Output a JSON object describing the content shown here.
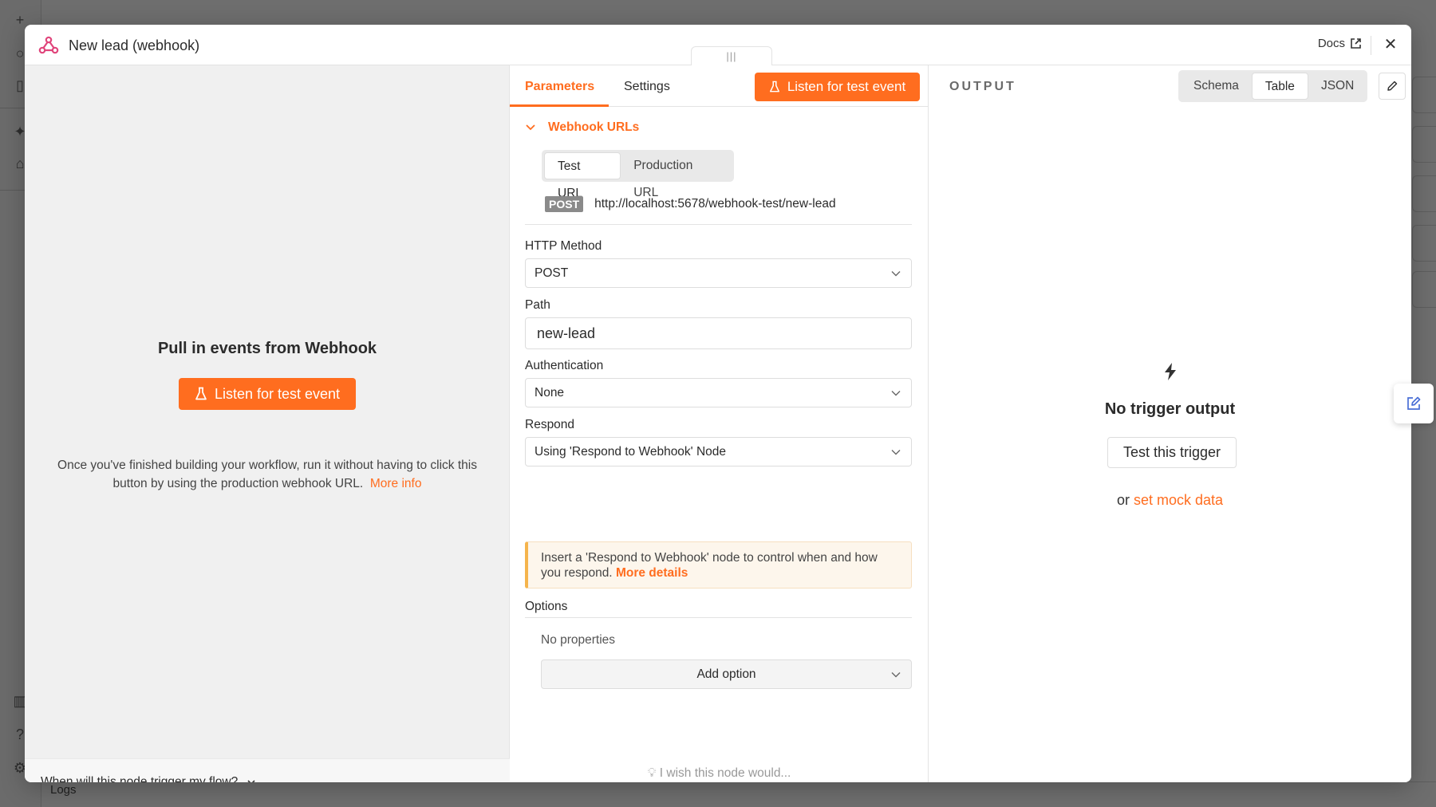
{
  "modal": {
    "title": "New lead (webhook)",
    "docs_label": "Docs",
    "drag_handle": "|||"
  },
  "left": {
    "heading": "Pull in events from Webhook",
    "listen_button": "Listen for test event",
    "description": "Once you've finished building your workflow, run it without having to click this button by using the production webhook URL.",
    "more_info": "More info",
    "footer_question": "When will this node trigger my flow?"
  },
  "middle": {
    "tabs": [
      {
        "label": "Parameters",
        "active": true
      },
      {
        "label": "Settings",
        "active": false
      }
    ],
    "listen_button": "Listen for test event",
    "webhook_section": "Webhook URLs",
    "url_tabs": [
      {
        "label": "Test URL",
        "active": true
      },
      {
        "label": "Production URL",
        "active": false
      }
    ],
    "url_method": "POST",
    "url": "http://localhost:5678/webhook-test/new-lead",
    "fields": {
      "http_method": {
        "label": "HTTP Method",
        "value": "POST"
      },
      "path": {
        "label": "Path",
        "value": "new-lead"
      },
      "authentication": {
        "label": "Authentication",
        "value": "None"
      },
      "respond": {
        "label": "Respond",
        "value": "Using 'Respond to Webhook' Node"
      }
    },
    "notice": {
      "text": "Insert a 'Respond to Webhook' node to control when and how you respond.",
      "link": "More details"
    },
    "options": {
      "label": "Options",
      "empty": "No properties",
      "add_button": "Add option"
    },
    "wish": "I wish this node would..."
  },
  "right": {
    "output_label": "OUTPUT",
    "views": [
      {
        "label": "Schema",
        "active": false
      },
      {
        "label": "Table",
        "active": true
      },
      {
        "label": "JSON",
        "active": false
      }
    ],
    "empty_title": "No trigger output",
    "test_button": "Test this trigger",
    "mock_prefix": "or",
    "mock_link": "set mock data"
  },
  "background": {
    "logs_label": "Logs"
  },
  "colors": {
    "accent": "#ff6d1f",
    "notice_border": "#f5b44c",
    "webhook_icon": "#e0457b"
  }
}
